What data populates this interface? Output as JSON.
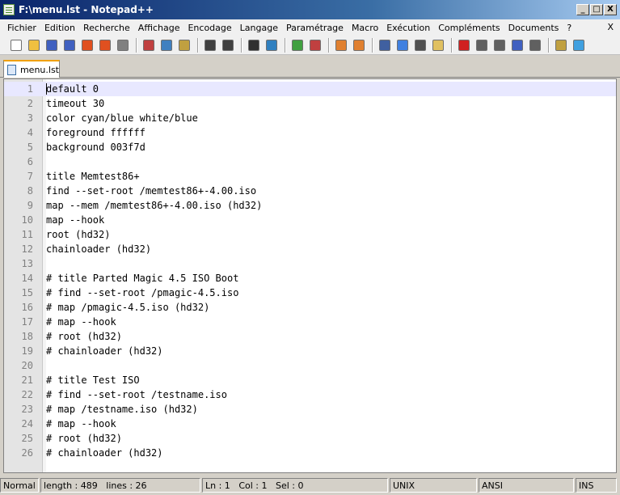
{
  "window": {
    "title": "F:\\menu.lst - Notepad++",
    "min_label": "_",
    "max_label": "□",
    "close_label": "X"
  },
  "menubar": {
    "items": [
      "Fichier",
      "Edition",
      "Recherche",
      "Affichage",
      "Encodage",
      "Langage",
      "Paramétrage",
      "Macro",
      "Exécution",
      "Compléments",
      "Documents",
      "?"
    ],
    "close_label": "X"
  },
  "toolbar": {
    "buttons": [
      {
        "icon": "new-file-icon",
        "color": "#ffffff"
      },
      {
        "icon": "open-file-icon",
        "color": "#f0c040"
      },
      {
        "icon": "save-icon",
        "color": "#4060c0"
      },
      {
        "icon": "save-all-icon",
        "color": "#4060c0"
      },
      {
        "icon": "close-file-icon",
        "color": "#e05020"
      },
      {
        "icon": "close-all-icon",
        "color": "#e05020"
      },
      {
        "icon": "print-icon",
        "color": "#808080"
      },
      "sep",
      {
        "icon": "cut-icon",
        "color": "#c04040"
      },
      {
        "icon": "copy-icon",
        "color": "#4080c0"
      },
      {
        "icon": "paste-icon",
        "color": "#c0a040"
      },
      "sep",
      {
        "icon": "undo-icon",
        "color": "#404040"
      },
      {
        "icon": "redo-icon",
        "color": "#404040"
      },
      "sep",
      {
        "icon": "find-icon",
        "color": "#303030"
      },
      {
        "icon": "replace-icon",
        "color": "#3080c0"
      },
      "sep",
      {
        "icon": "zoom-in-icon",
        "color": "#40a040"
      },
      {
        "icon": "zoom-out-icon",
        "color": "#c04040"
      },
      "sep",
      {
        "icon": "sync-vertical-icon",
        "color": "#e08030"
      },
      {
        "icon": "sync-horizontal-icon",
        "color": "#e08030"
      },
      "sep",
      {
        "icon": "word-wrap-icon",
        "color": "#4060a0"
      },
      {
        "icon": "show-all-chars-icon",
        "color": "#4080e0"
      },
      {
        "icon": "indent-guide-icon",
        "color": "#505050"
      },
      {
        "icon": "document-map-icon",
        "color": "#e0c060"
      },
      "sep",
      {
        "icon": "record-macro-icon",
        "color": "#d02020"
      },
      {
        "icon": "stop-macro-icon",
        "color": "#606060"
      },
      {
        "icon": "play-macro-icon",
        "color": "#606060"
      },
      {
        "icon": "play-multiple-icon",
        "color": "#4060c0"
      },
      {
        "icon": "save-macro-icon",
        "color": "#606060"
      },
      "sep",
      {
        "icon": "plugin-icon",
        "color": "#c0a040"
      },
      {
        "icon": "spell-check-icon",
        "color": "#40a0e0"
      }
    ]
  },
  "tabs": [
    {
      "label": "menu.lst",
      "active": true
    }
  ],
  "editor": {
    "lines": [
      "default 0",
      "timeout 30",
      "color cyan/blue white/blue",
      "foreground ffffff",
      "background 003f7d",
      "",
      "title Memtest86+",
      "find --set-root /memtest86+-4.00.iso",
      "map --mem /memtest86+-4.00.iso (hd32)",
      "map --hook",
      "root (hd32)",
      "chainloader (hd32)",
      "",
      "# title Parted Magic 4.5 ISO Boot",
      "# find --set-root /pmagic-4.5.iso",
      "# map /pmagic-4.5.iso (hd32)",
      "# map --hook",
      "# root (hd32)",
      "# chainloader (hd32)",
      "",
      "# title Test ISO",
      "# find --set-root /testname.iso",
      "# map /testname.iso (hd32)",
      "# map --hook",
      "# root (hd32)",
      "# chainloader (hd32)"
    ],
    "current_line": 1
  },
  "status": {
    "type": "Normal te",
    "length": "length : 489",
    "lines": "lines : 26",
    "ln": "Ln : 1",
    "col": "Col : 1",
    "sel": "Sel : 0",
    "eol": "UNIX",
    "encoding": "ANSI",
    "mode": "INS"
  }
}
